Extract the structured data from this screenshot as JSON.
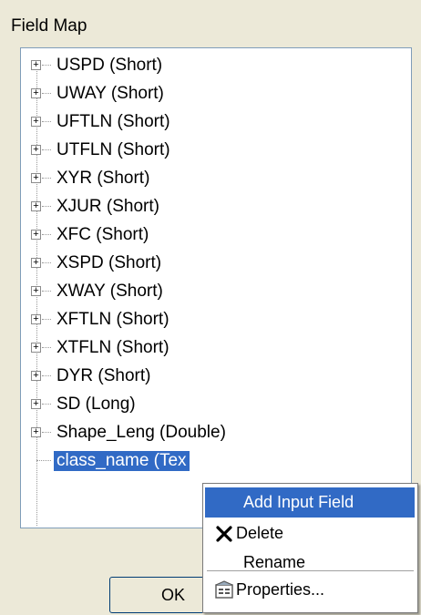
{
  "group": {
    "label": "Field Map"
  },
  "tree": {
    "items": [
      {
        "label": "USPD (Short)"
      },
      {
        "label": "UWAY (Short)"
      },
      {
        "label": "UFTLN (Short)"
      },
      {
        "label": "UTFLN (Short)"
      },
      {
        "label": "XYR (Short)"
      },
      {
        "label": "XJUR (Short)"
      },
      {
        "label": "XFC (Short)"
      },
      {
        "label": "XSPD (Short)"
      },
      {
        "label": "XWAY (Short)"
      },
      {
        "label": "XFTLN (Short)"
      },
      {
        "label": "XTFLN (Short)"
      },
      {
        "label": "DYR (Short)"
      },
      {
        "label": "SD (Long)"
      },
      {
        "label": "Shape_Leng (Double)"
      }
    ],
    "selected": {
      "label": "class_name (Tex"
    },
    "expander_glyph": "+"
  },
  "buttons": {
    "ok": "OK"
  },
  "context_menu": {
    "items": [
      {
        "label": "Add Input Field",
        "icon": ""
      },
      {
        "label": "Delete",
        "icon": "delete-x-icon"
      },
      {
        "label": "Rename",
        "icon": ""
      },
      {
        "label": "Properties...",
        "icon": "properties-icon"
      }
    ]
  },
  "colors": {
    "selection": "#316ac5",
    "dialog_bg": "#ece9d8"
  }
}
